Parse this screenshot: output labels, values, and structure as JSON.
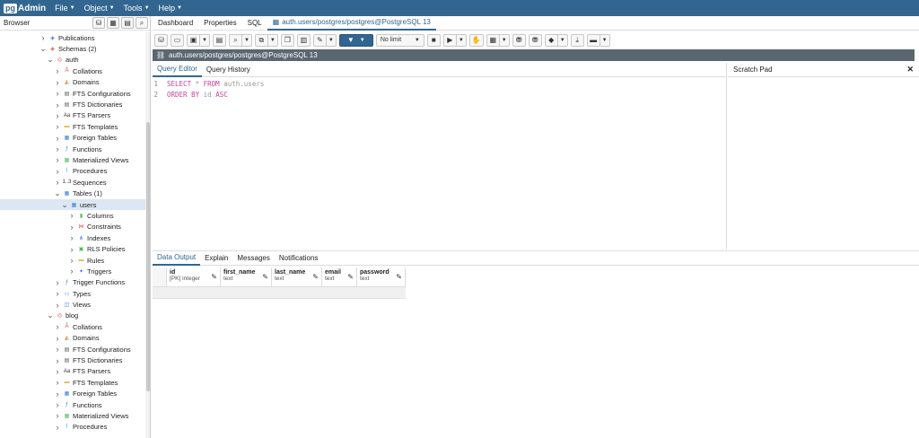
{
  "app": {
    "logo_pg": "pg",
    "logo_admin": "Admin"
  },
  "menu": [
    "File",
    "Object",
    "Tools",
    "Help"
  ],
  "browser": {
    "title": "Browser",
    "tree": [
      {
        "label": "Publications",
        "indent": 3,
        "open": false,
        "icon": "publications-icon",
        "color": "#3a7bd5"
      },
      {
        "label": "Schemas (2)",
        "indent": 3,
        "open": true,
        "icon": "schemas-icon",
        "color": "#d9534f"
      },
      {
        "label": "auth",
        "indent": 4,
        "open": true,
        "icon": "schema-icon",
        "color": "#d9534f"
      },
      {
        "label": "Collations",
        "indent": 5,
        "open": false,
        "icon": "collations-icon",
        "color": "#d9534f"
      },
      {
        "label": "Domains",
        "indent": 5,
        "open": false,
        "icon": "domains-icon",
        "color": "#c47a2c"
      },
      {
        "label": "FTS Configurations",
        "indent": 5,
        "open": false,
        "icon": "fts-config-icon",
        "color": "#555"
      },
      {
        "label": "FTS Dictionaries",
        "indent": 5,
        "open": false,
        "icon": "fts-dict-icon",
        "color": "#555"
      },
      {
        "label": "FTS Parsers",
        "indent": 5,
        "open": false,
        "icon": "fts-parsers-icon",
        "color": "#333"
      },
      {
        "label": "FTS Templates",
        "indent": 5,
        "open": false,
        "icon": "fts-templates-icon",
        "color": "#e8b84a"
      },
      {
        "label": "Foreign Tables",
        "indent": 5,
        "open": false,
        "icon": "foreign-tables-icon",
        "color": "#3a7bd5"
      },
      {
        "label": "Functions",
        "indent": 5,
        "open": false,
        "icon": "functions-icon",
        "color": "#3a7bd5"
      },
      {
        "label": "Materialized Views",
        "indent": 5,
        "open": false,
        "icon": "mat-views-icon",
        "color": "#5cb85c"
      },
      {
        "label": "Procedures",
        "indent": 5,
        "open": false,
        "icon": "procedures-icon",
        "color": "#3a7bd5"
      },
      {
        "label": "Sequences",
        "indent": 5,
        "open": false,
        "icon": "sequences-icon",
        "color": "#333"
      },
      {
        "label": "Tables (1)",
        "indent": 5,
        "open": true,
        "icon": "tables-icon",
        "color": "#3a7bd5"
      },
      {
        "label": "users",
        "indent": 6,
        "open": true,
        "icon": "table-icon",
        "color": "#3a7bd5",
        "selected": true
      },
      {
        "label": "Columns",
        "indent": 7,
        "open": false,
        "icon": "columns-icon",
        "color": "#5cb85c"
      },
      {
        "label": "Constraints",
        "indent": 7,
        "open": false,
        "icon": "constraints-icon",
        "color": "#d9534f"
      },
      {
        "label": "Indexes",
        "indent": 7,
        "open": false,
        "icon": "indexes-icon",
        "color": "#3a7bd5"
      },
      {
        "label": "RLS Policies",
        "indent": 7,
        "open": false,
        "icon": "rls-icon",
        "color": "#5cb85c"
      },
      {
        "label": "Rules",
        "indent": 7,
        "open": false,
        "icon": "rules-icon",
        "color": "#e8b84a"
      },
      {
        "label": "Triggers",
        "indent": 7,
        "open": false,
        "icon": "triggers-icon",
        "color": "#3a7bd5"
      },
      {
        "label": "Trigger Functions",
        "indent": 5,
        "open": false,
        "icon": "trigger-functions-icon",
        "color": "#3a7bd5"
      },
      {
        "label": "Types",
        "indent": 5,
        "open": false,
        "icon": "types-icon",
        "color": "#3a7bd5"
      },
      {
        "label": "Views",
        "indent": 5,
        "open": false,
        "icon": "views-icon",
        "color": "#3a7bd5"
      },
      {
        "label": "blog",
        "indent": 4,
        "open": true,
        "icon": "schema-icon",
        "color": "#d9534f"
      },
      {
        "label": "Collations",
        "indent": 5,
        "open": false,
        "icon": "collations-icon",
        "color": "#d9534f"
      },
      {
        "label": "Domains",
        "indent": 5,
        "open": false,
        "icon": "domains-icon",
        "color": "#c47a2c"
      },
      {
        "label": "FTS Configurations",
        "indent": 5,
        "open": false,
        "icon": "fts-config-icon",
        "color": "#555"
      },
      {
        "label": "FTS Dictionaries",
        "indent": 5,
        "open": false,
        "icon": "fts-dict-icon",
        "color": "#555"
      },
      {
        "label": "FTS Parsers",
        "indent": 5,
        "open": false,
        "icon": "fts-parsers-icon",
        "color": "#333"
      },
      {
        "label": "FTS Templates",
        "indent": 5,
        "open": false,
        "icon": "fts-templates-icon",
        "color": "#e8b84a"
      },
      {
        "label": "Foreign Tables",
        "indent": 5,
        "open": false,
        "icon": "foreign-tables-icon",
        "color": "#3a7bd5"
      },
      {
        "label": "Functions",
        "indent": 5,
        "open": false,
        "icon": "functions-icon",
        "color": "#3a7bd5"
      },
      {
        "label": "Materialized Views",
        "indent": 5,
        "open": false,
        "icon": "mat-views-icon",
        "color": "#5cb85c"
      },
      {
        "label": "Procedures",
        "indent": 5,
        "open": false,
        "icon": "procedures-icon",
        "color": "#3a7bd5"
      }
    ]
  },
  "main_tabs": [
    "Dashboard",
    "Properties",
    "SQL",
    "auth.users/postgres/postgres@PostgreSQL 13"
  ],
  "toolbar": {
    "limit": "No limit"
  },
  "connection": "auth.users/postgres/postgres@PostgreSQL 13",
  "query_tabs": [
    "Query Editor",
    "Query History"
  ],
  "code": [
    {
      "n": "1",
      "parts": [
        [
          "kw",
          "SELECT"
        ],
        [
          "id",
          " * "
        ],
        [
          "kw",
          "FROM"
        ],
        [
          "id",
          " auth.users"
        ]
      ]
    },
    {
      "n": "2",
      "parts": [
        [
          "kw",
          "ORDER BY"
        ],
        [
          "id",
          " id "
        ],
        [
          "kw",
          "ASC"
        ]
      ]
    }
  ],
  "scratch_pad": {
    "title": "Scratch Pad"
  },
  "output_tabs": [
    "Data Output",
    "Explain",
    "Messages",
    "Notifications"
  ],
  "columns": [
    {
      "name": "id",
      "type": "[PK] integer"
    },
    {
      "name": "first_name",
      "type": "text"
    },
    {
      "name": "last_name",
      "type": "text"
    },
    {
      "name": "email",
      "type": "text"
    },
    {
      "name": "password",
      "type": "text"
    }
  ],
  "colors": {
    "brand": "#326690",
    "conn_bar": "#5a6770",
    "keyword": "#c8449c"
  }
}
